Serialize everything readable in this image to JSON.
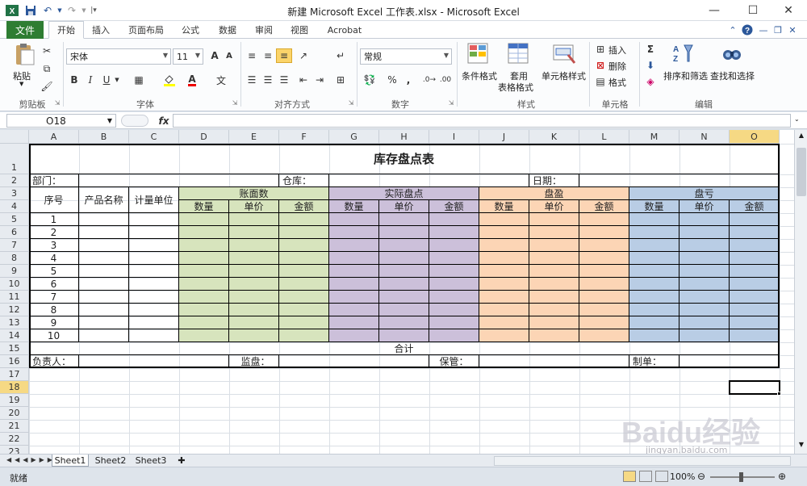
{
  "window": {
    "title": "新建 Microsoft Excel 工作表.xlsx - Microsoft Excel",
    "minimize_icon": "minimize-icon",
    "maximize_icon": "maximize-icon",
    "close_icon": "close-icon"
  },
  "tabs": [
    "文件",
    "开始",
    "插入",
    "页面布局",
    "公式",
    "数据",
    "审阅",
    "视图",
    "Acrobat"
  ],
  "ribbon": {
    "clipboard": {
      "paste": "粘贴",
      "label": "剪贴板"
    },
    "font": {
      "name": "宋体",
      "size": "11",
      "bold": "B",
      "italic": "I",
      "underline": "U",
      "label": "字体",
      "grow": "A",
      "shrink": "A",
      "font_color": "A"
    },
    "alignment": {
      "label": "对齐方式"
    },
    "number": {
      "format": "常规",
      "percent": "%",
      "comma": ",",
      "label": "数字"
    },
    "styles": {
      "conditional": "条件格式",
      "table_line1": "套用",
      "table_line2": "表格格式",
      "cell_styles": "单元格样式",
      "label": "样式"
    },
    "cells": {
      "insert": "插入",
      "delete": "删除",
      "format": "格式",
      "label": "单元格"
    },
    "editing": {
      "sigma": "Σ",
      "sort": "排序和筛选",
      "find": "查找和选择",
      "label": "编辑"
    }
  },
  "formula_bar": {
    "name_box": "O18",
    "fx": "fx"
  },
  "columns": [
    "A",
    "B",
    "C",
    "D",
    "E",
    "F",
    "G",
    "H",
    "I",
    "J",
    "K",
    "L",
    "M",
    "N",
    "O"
  ],
  "rows": [
    "1",
    "2",
    "3",
    "4",
    "5",
    "6",
    "7",
    "8",
    "9",
    "10",
    "11",
    "12",
    "13",
    "14",
    "15",
    "16",
    "17",
    "18",
    "19",
    "20",
    "21",
    "22",
    "23"
  ],
  "sheet": {
    "title": "库存盘点表",
    "dept_label": "部门：",
    "warehouse_label": "仓库：",
    "date_label": "日期：",
    "seq_header": "序号",
    "product_header": "产品名称",
    "unit_header": "计量单位",
    "groups": [
      {
        "name": "账面数",
        "color": "#d7e4bd"
      },
      {
        "name": "实际盘点",
        "color": "#ccc0da"
      },
      {
        "name": "盘盈",
        "color": "#fcd5b5"
      },
      {
        "name": "盘亏",
        "color": "#b9cde5"
      }
    ],
    "sub_headers": [
      "数量",
      "单价",
      "金额"
    ],
    "row_numbers": [
      "1",
      "2",
      "3",
      "4",
      "5",
      "6",
      "7",
      "8",
      "9",
      "10"
    ],
    "total_label": "合计",
    "responsible_label": "负责人：",
    "supervisor_label": "监盘：",
    "keeper_label": "保管：",
    "maker_label": "制单："
  },
  "sheet_tabs": [
    "Sheet1",
    "Sheet2",
    "Sheet3"
  ],
  "status": {
    "ready": "就绪",
    "zoom": "100%"
  },
  "watermark": "Baidu经验",
  "watermark_url": "jingyan.baidu.com"
}
